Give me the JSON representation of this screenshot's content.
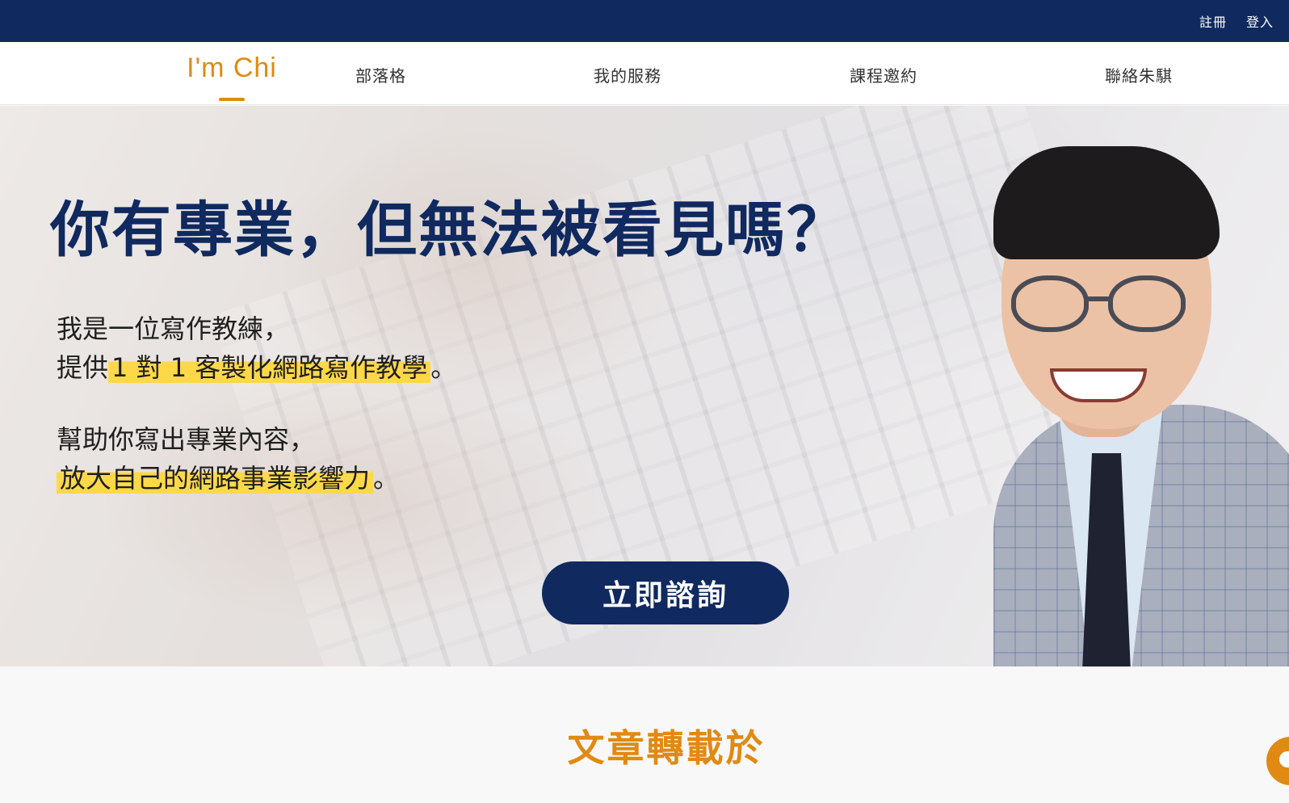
{
  "topbar": {
    "register_label": "註冊",
    "login_label": "登入"
  },
  "nav": {
    "logo_text": "I'm Chi",
    "items": [
      {
        "label": "部落格"
      },
      {
        "label": "我的服務"
      },
      {
        "label": "課程邀約"
      },
      {
        "label": "聯絡朱騏"
      }
    ]
  },
  "hero": {
    "headline": "你有專業，但無法被看見嗎？",
    "line1": "我是一位寫作教練，",
    "line2_prefix": "提供",
    "line2_highlight": "1 對 1 客製化網路寫作教學",
    "line2_suffix": "。",
    "line3": "幫助你寫出專業內容，",
    "line4_highlight": "放大自己的網路事業影響力",
    "line4_suffix": "。",
    "cta_label": "立即諮詢"
  },
  "section": {
    "title": "文章轉載於"
  },
  "colors": {
    "navy": "#10295f",
    "accent": "#e08a12",
    "highlight": "#ffd84a"
  }
}
